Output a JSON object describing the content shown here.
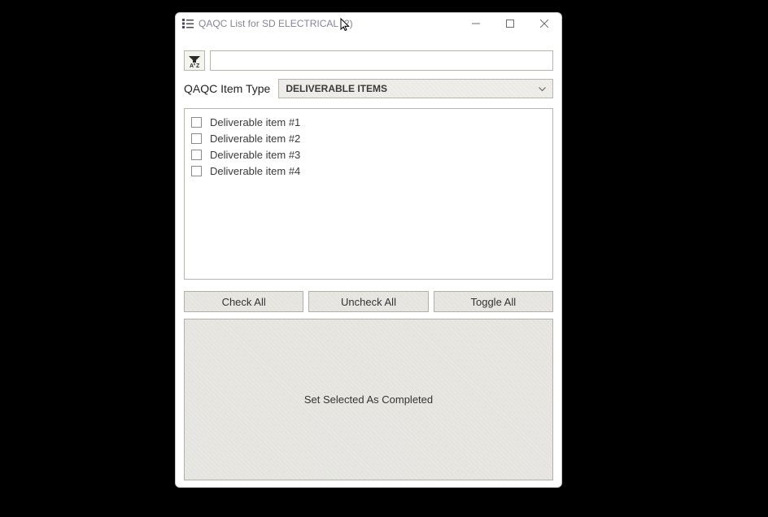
{
  "window": {
    "title": "QAQC List for SD ELECTRICAL (2)"
  },
  "toolbar": {
    "search_value": "",
    "search_placeholder": ""
  },
  "type": {
    "label": "QAQC Item Type",
    "selected": "DELIVERABLE ITEMS"
  },
  "items": [
    {
      "label": "Deliverable item #1",
      "checked": false
    },
    {
      "label": "Deliverable item #2",
      "checked": false
    },
    {
      "label": "Deliverable item #3",
      "checked": false
    },
    {
      "label": "Deliverable item #4",
      "checked": false
    }
  ],
  "buttons": {
    "check_all": "Check All",
    "uncheck_all": "Uncheck All",
    "toggle_all": "Toggle All",
    "set_completed": "Set Selected As Completed"
  }
}
